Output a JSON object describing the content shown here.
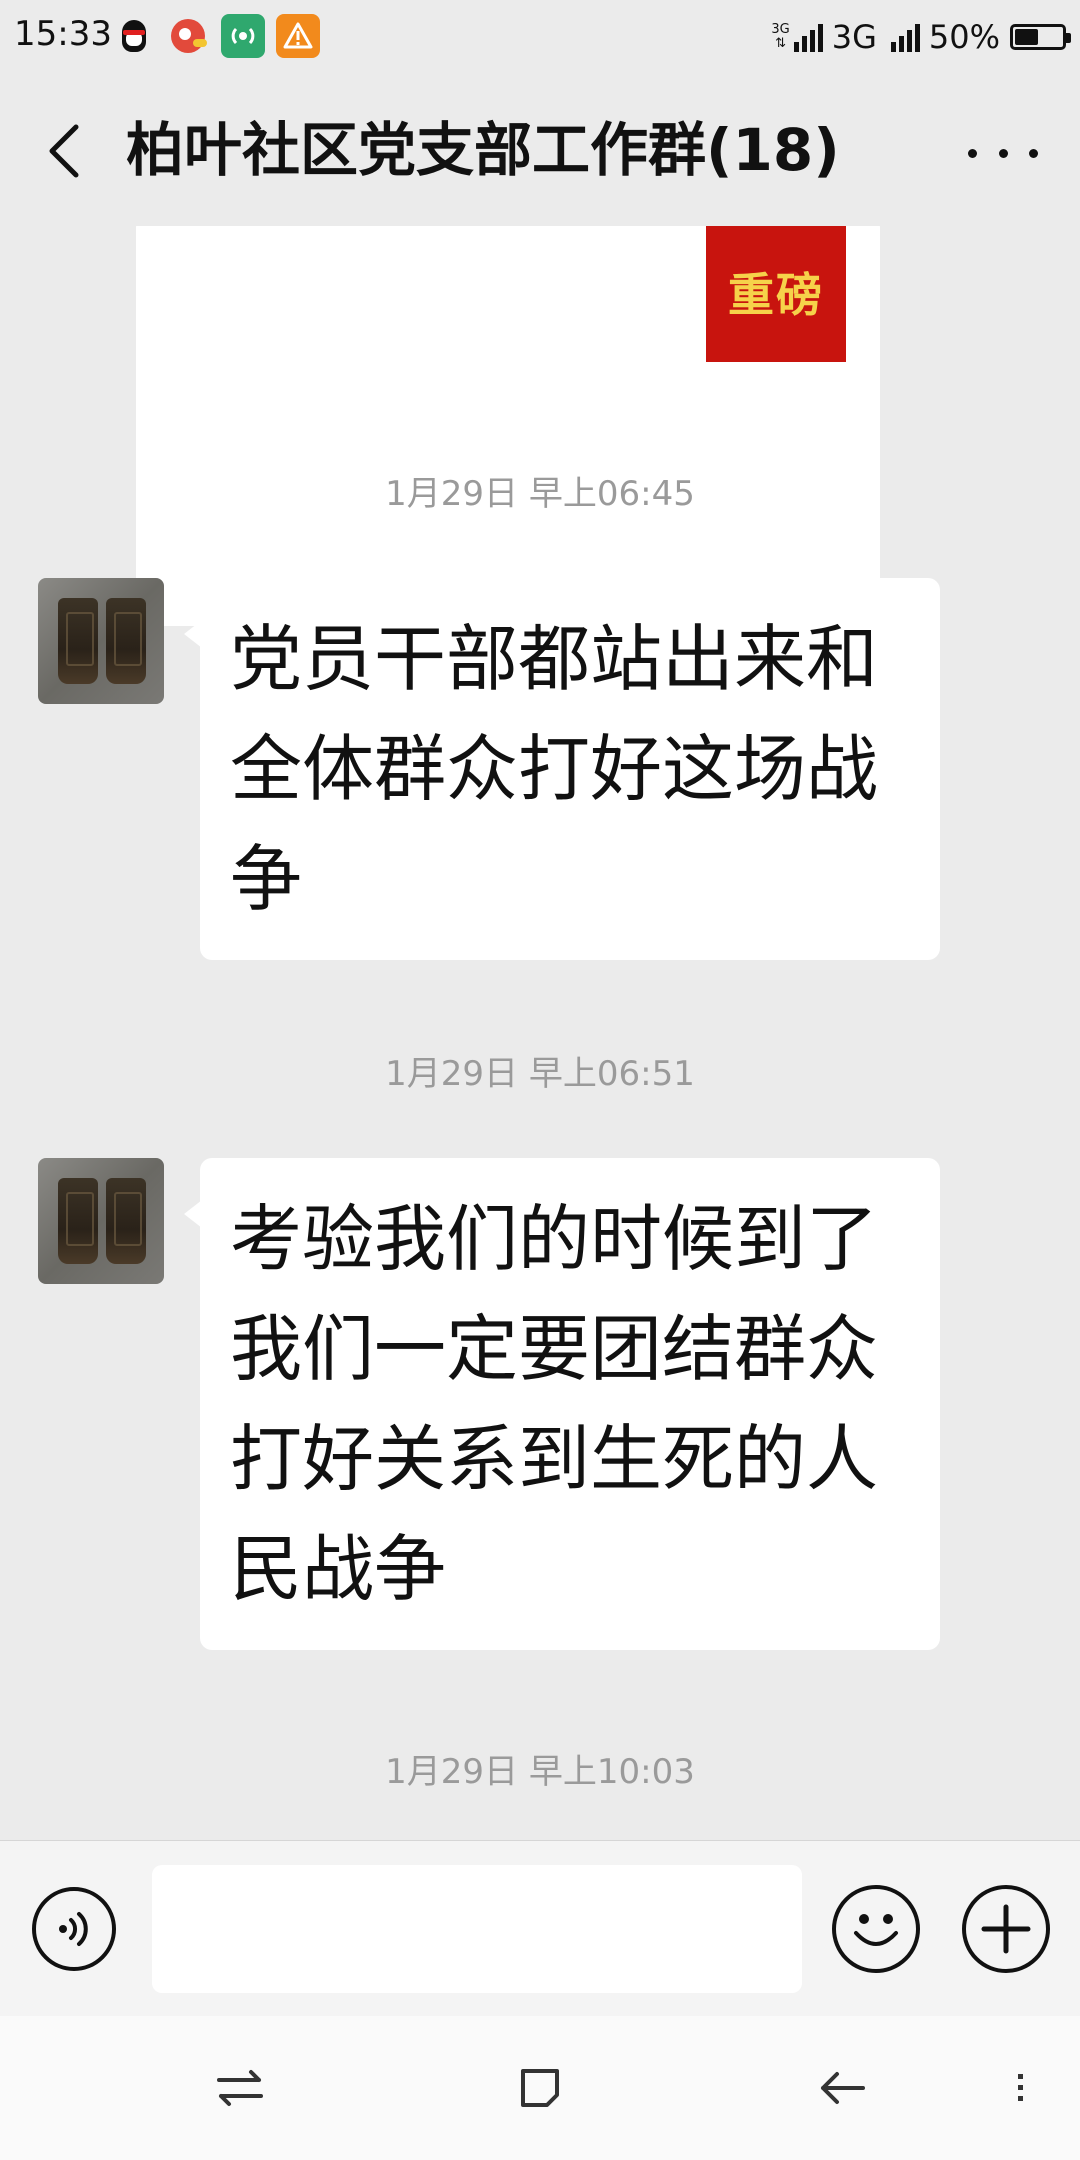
{
  "status_bar": {
    "time": "15:33",
    "network_small_label": "3G",
    "network_label": "3G",
    "battery_percent": "50%",
    "battery_level": 0.5,
    "app_icons": [
      "qq-icon",
      "bird-icon",
      "signal-app-icon",
      "warning-icon"
    ]
  },
  "header": {
    "title": "柏叶社区党支部工作群(18)"
  },
  "shared_card": {
    "cover_text": "重磅"
  },
  "messages": [
    {
      "timestamp": "1月29日 早上06:45",
      "text": "党员干部都站出来和全体群众打好这场战争"
    },
    {
      "timestamp": "1月29日 早上06:51",
      "text": "考验我们的时候到了我们一定要团结群众打好关系到生死的人民战争"
    }
  ],
  "last_timestamp": "1月29日 早上10:03",
  "input_bar": {
    "value": ""
  }
}
